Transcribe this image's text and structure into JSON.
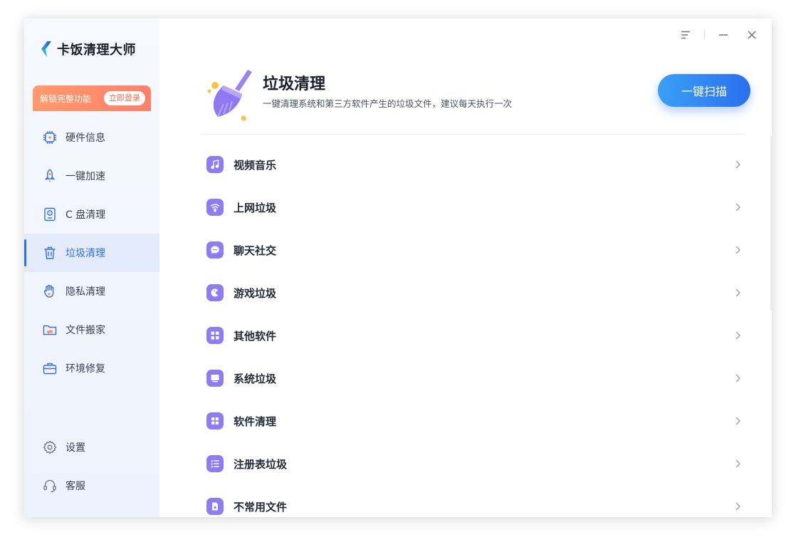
{
  "app": {
    "name": "卡饭清理大师"
  },
  "unlock": {
    "text": "解锁完整功能",
    "button": "立即登录"
  },
  "nav": [
    {
      "label": "硬件信息",
      "icon": "chip-icon"
    },
    {
      "label": "一键加速",
      "icon": "rocket-icon"
    },
    {
      "label": "C 盘清理",
      "icon": "drive-icon"
    },
    {
      "label": "垃圾清理",
      "icon": "trash-icon",
      "active": true
    },
    {
      "label": "隐私清理",
      "icon": "hand-icon"
    },
    {
      "label": "文件搬家",
      "icon": "folder-move-icon"
    },
    {
      "label": "环境修复",
      "icon": "toolbox-icon"
    }
  ],
  "bottom_nav": [
    {
      "label": "设置",
      "icon": "gear-icon"
    },
    {
      "label": "客服",
      "icon": "headset-icon"
    }
  ],
  "header": {
    "title": "垃圾清理",
    "subtitle": "一键清理系统和第三方软件产生的垃圾文件，建议每天执行一次",
    "scan_button": "一键扫描"
  },
  "categories": [
    {
      "label": "视频音乐",
      "icon": "music-icon"
    },
    {
      "label": "上网垃圾",
      "icon": "wifi-icon"
    },
    {
      "label": "聊天社交",
      "icon": "chat-icon"
    },
    {
      "label": "游戏垃圾",
      "icon": "game-icon"
    },
    {
      "label": "其他软件",
      "icon": "grid-icon"
    },
    {
      "label": "系统垃圾",
      "icon": "monitor-icon"
    },
    {
      "label": "软件清理",
      "icon": "apps-icon"
    },
    {
      "label": "注册表垃圾",
      "icon": "list-icon"
    },
    {
      "label": "不常用文件",
      "icon": "file-icon"
    }
  ],
  "colors": {
    "accent": "#2f6ff0",
    "category_icon": "#8d7df5",
    "unlock_bg": "#ff8a6b"
  }
}
